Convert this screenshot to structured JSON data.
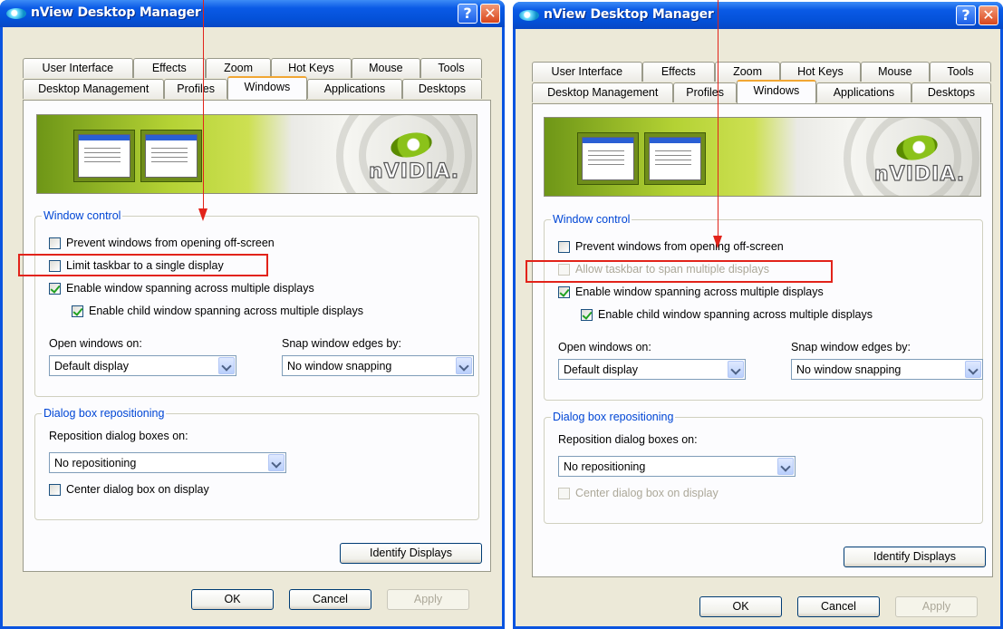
{
  "dialog_a": {
    "title": "nView Desktop Manager",
    "help_glyph": "?",
    "close_glyph": "✕",
    "tabs_row1": [
      "User Interface",
      "Effects",
      "Zoom",
      "Hot Keys",
      "Mouse",
      "Tools"
    ],
    "tabs_row2": [
      "Desktop Management",
      "Profiles",
      "Windows",
      "Applications",
      "Desktops"
    ],
    "active_tab": "Windows",
    "banner_logo": "nVIDIA.",
    "window_control": {
      "label": "Window control",
      "prevent_offscreen": "Prevent windows from opening off-screen",
      "taskbar_option": "Limit taskbar to a single display",
      "enable_spanning": "Enable window spanning across multiple displays",
      "enable_child_spanning": "Enable child window spanning across multiple displays",
      "open_windows_label": "Open windows on:",
      "open_windows_value": "Default display",
      "snap_label": "Snap window edges by:",
      "snap_value": "No window snapping"
    },
    "dialog_repositioning": {
      "label": "Dialog box repositioning",
      "reposition_label": "Reposition dialog boxes on:",
      "reposition_value": "No repositioning",
      "center_label": "Center dialog box on display"
    },
    "identify_button": "Identify Displays",
    "ok_button": "OK",
    "cancel_button": "Cancel",
    "apply_button": "Apply"
  },
  "dialog_b": {
    "title": "nView Desktop Manager",
    "help_glyph": "?",
    "close_glyph": "✕",
    "tabs_row1": [
      "User Interface",
      "Effects",
      "Zoom",
      "Hot Keys",
      "Mouse",
      "Tools"
    ],
    "tabs_row2": [
      "Desktop Management",
      "Profiles",
      "Windows",
      "Applications",
      "Desktops"
    ],
    "active_tab": "Windows",
    "banner_logo": "nVIDIA.",
    "window_control": {
      "label": "Window control",
      "prevent_offscreen": "Prevent windows from opening off-screen",
      "taskbar_option": "Allow taskbar to span multiple displays",
      "enable_spanning": "Enable window spanning across multiple displays",
      "enable_child_spanning": "Enable child window spanning across multiple displays",
      "open_windows_label": "Open windows on:",
      "open_windows_value": "Default display",
      "snap_label": "Snap window edges by:",
      "snap_value": "No window snapping"
    },
    "dialog_repositioning": {
      "label": "Dialog box repositioning",
      "reposition_label": "Reposition dialog boxes on:",
      "reposition_value": "No repositioning",
      "center_label": "Center dialog box on display"
    },
    "identify_button": "Identify Displays",
    "ok_button": "OK",
    "cancel_button": "Cancel",
    "apply_button": "Apply"
  },
  "states": {
    "a": {
      "prevent_offscreen": false,
      "taskbar": false,
      "enable_spanning": true,
      "child_spanning": true,
      "center": false
    },
    "b": {
      "prevent_offscreen": false,
      "taskbar": false,
      "taskbar_disabled": true,
      "enable_spanning": true,
      "child_spanning": true,
      "center": false,
      "center_disabled": true,
      "apply_disabled": true
    }
  },
  "colors": {
    "title_blue": "#0a54e0",
    "annotation_red": "#e2231a",
    "group_label_blue": "#0046d5",
    "nvidia_green": "#76b900"
  },
  "icons": {
    "title_icon": "nview-icon",
    "help": "help-icon",
    "close": "close-icon",
    "dropdown": "chevron-down-icon"
  }
}
